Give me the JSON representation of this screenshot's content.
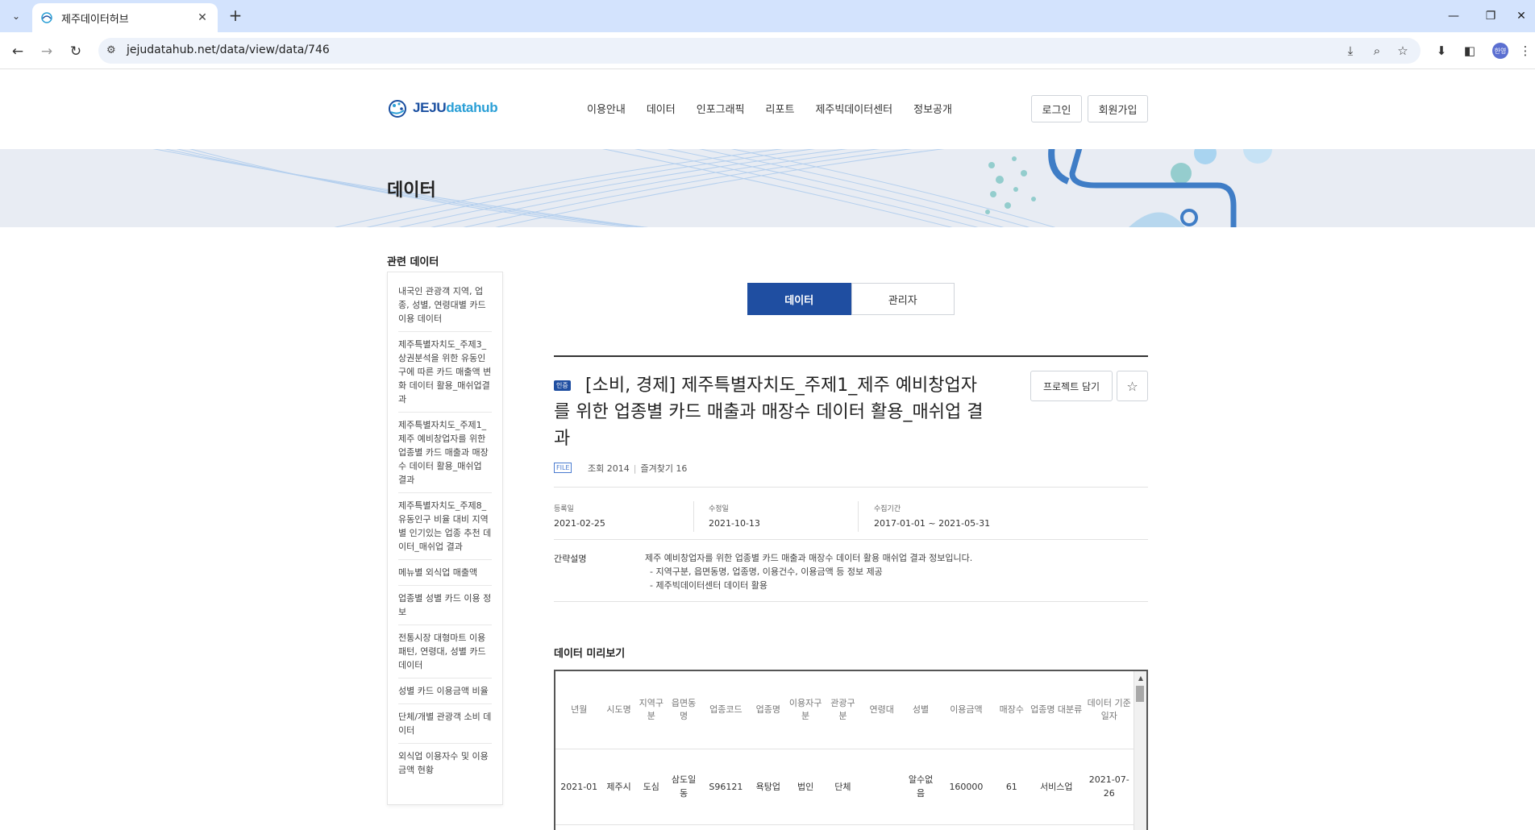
{
  "browser": {
    "tab_title": "제주데이터허브",
    "tab_close": "✕",
    "new_tab": "+",
    "url": "jejudatahub.net/data/view/data/746",
    "profile_initial": "한영"
  },
  "site": {
    "logo_prefix": "JEJU",
    "logo_suffix": "datahub",
    "nav": [
      "이용안내",
      "데이터",
      "인포그래픽",
      "리포트",
      "제주빅데이터센터",
      "정보공개"
    ],
    "login_label": "로그인",
    "signup_label": "회원가입"
  },
  "banner": {
    "title": "데이터"
  },
  "sidebar": {
    "title": "관련 데이터",
    "items": [
      "내국인 관광객 지역, 업종, 성별, 연령대별 카드 이용 데이터",
      "제주특별자치도_주제3_상권분석을 위한 유동인구에 따른 카드 매출액 변화 데이터 활용_매쉬업결과",
      "제주특별자치도_주제1_제주 예비창업자를 위한 업종별 카드 매출과 매장수 데이터 활용_매쉬업 결과",
      "제주특별자치도_주제8_유동인구 비율 대비 지역별 인기있는 업종 추천 데이터_매쉬업 결과",
      "메뉴별 외식업 매출액",
      "업종별 성별 카드 이용 정보",
      "전통시장 대형마트 이용패턴, 연령대, 성별 카드 데이터",
      "성별 카드 이용금액 비율",
      "단체/개별 관광객 소비 데이터",
      "외식업 이용자수 및 이용금액 현황"
    ]
  },
  "main": {
    "tab_data": "데이터",
    "tab_admin": "관리자",
    "badge": "인증",
    "title": "[소비, 경제] 제주특별자치도_주제1_제주 예비창업자를 위한 업종별 카드 매출과 매장수 데이터 활용_매쉬업 결과",
    "project_button": "프로젝트 담기",
    "star_icon": "☆",
    "file_tag": "FILE",
    "views": "조회 2014",
    "favorites": "즐겨찾기 16",
    "registered_label": "등록일",
    "registered_value": "2021-02-25",
    "modified_label": "수정일",
    "modified_value": "2021-10-13",
    "collection_label": "수집기간",
    "collection_value": "2017-01-01 ~ 2021-05-31",
    "desc_label": "간략설명",
    "desc_lines": [
      "제주 예비창업자를 위한 업종별 카드 매출과 매장수 데이터 활용 매쉬업 결과 정보입니다.",
      "- 지역구분, 읍면동명, 업종명, 이용건수, 이용금액 등 정보 제공",
      "- 제주빅데이터센터 데이터 활용"
    ],
    "preview_title": "데이터 미리보기"
  },
  "table": {
    "headers": [
      "년월",
      "시도명",
      "지역구분",
      "읍면동명",
      "업종코드",
      "업종명",
      "이용자구분",
      "관광구분",
      "연령대",
      "성별",
      "이용금액",
      "매장수",
      "업종명 대분류",
      "데이터 기준일자"
    ],
    "rows": [
      [
        "2021-01",
        "제주시",
        "도심",
        "삼도일동",
        "S96121",
        "욕탕업",
        "법인",
        "단체",
        "",
        "알수없음",
        "160000",
        "61",
        "서비스업",
        "2021-07-26"
      ]
    ]
  },
  "colors": {
    "primary": "#1f4ea1",
    "banner_bg": "#e8ecf3",
    "chrome_tab_bg": "#d3e3fd"
  }
}
